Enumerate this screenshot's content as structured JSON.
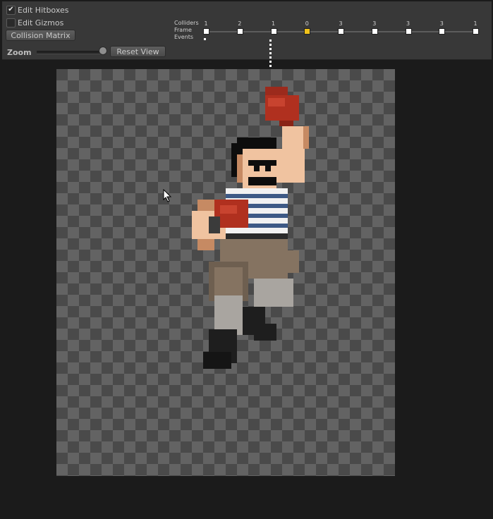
{
  "toolbar": {
    "edit_hitboxes": {
      "label": "Edit Hitboxes",
      "checked": true
    },
    "edit_gizmos": {
      "label": "Edit Gizmos",
      "checked": false
    },
    "collision_matrix_label": "Collision Matrix",
    "zoom_label": "Zoom",
    "zoom_level": 0.95,
    "reset_view_label": "Reset View"
  },
  "timeline": {
    "row_labels": {
      "colliders": "Colliders",
      "frame": "Frame",
      "events": "Events"
    },
    "colliders": [
      "1",
      "2",
      "1",
      "0",
      "3",
      "3",
      "3",
      "3",
      "1"
    ],
    "current_frame": 3,
    "active_color": "#f0c21a"
  },
  "canvas": {
    "sprite": "pixel-art boxer with raised red glove and striped shirt"
  }
}
